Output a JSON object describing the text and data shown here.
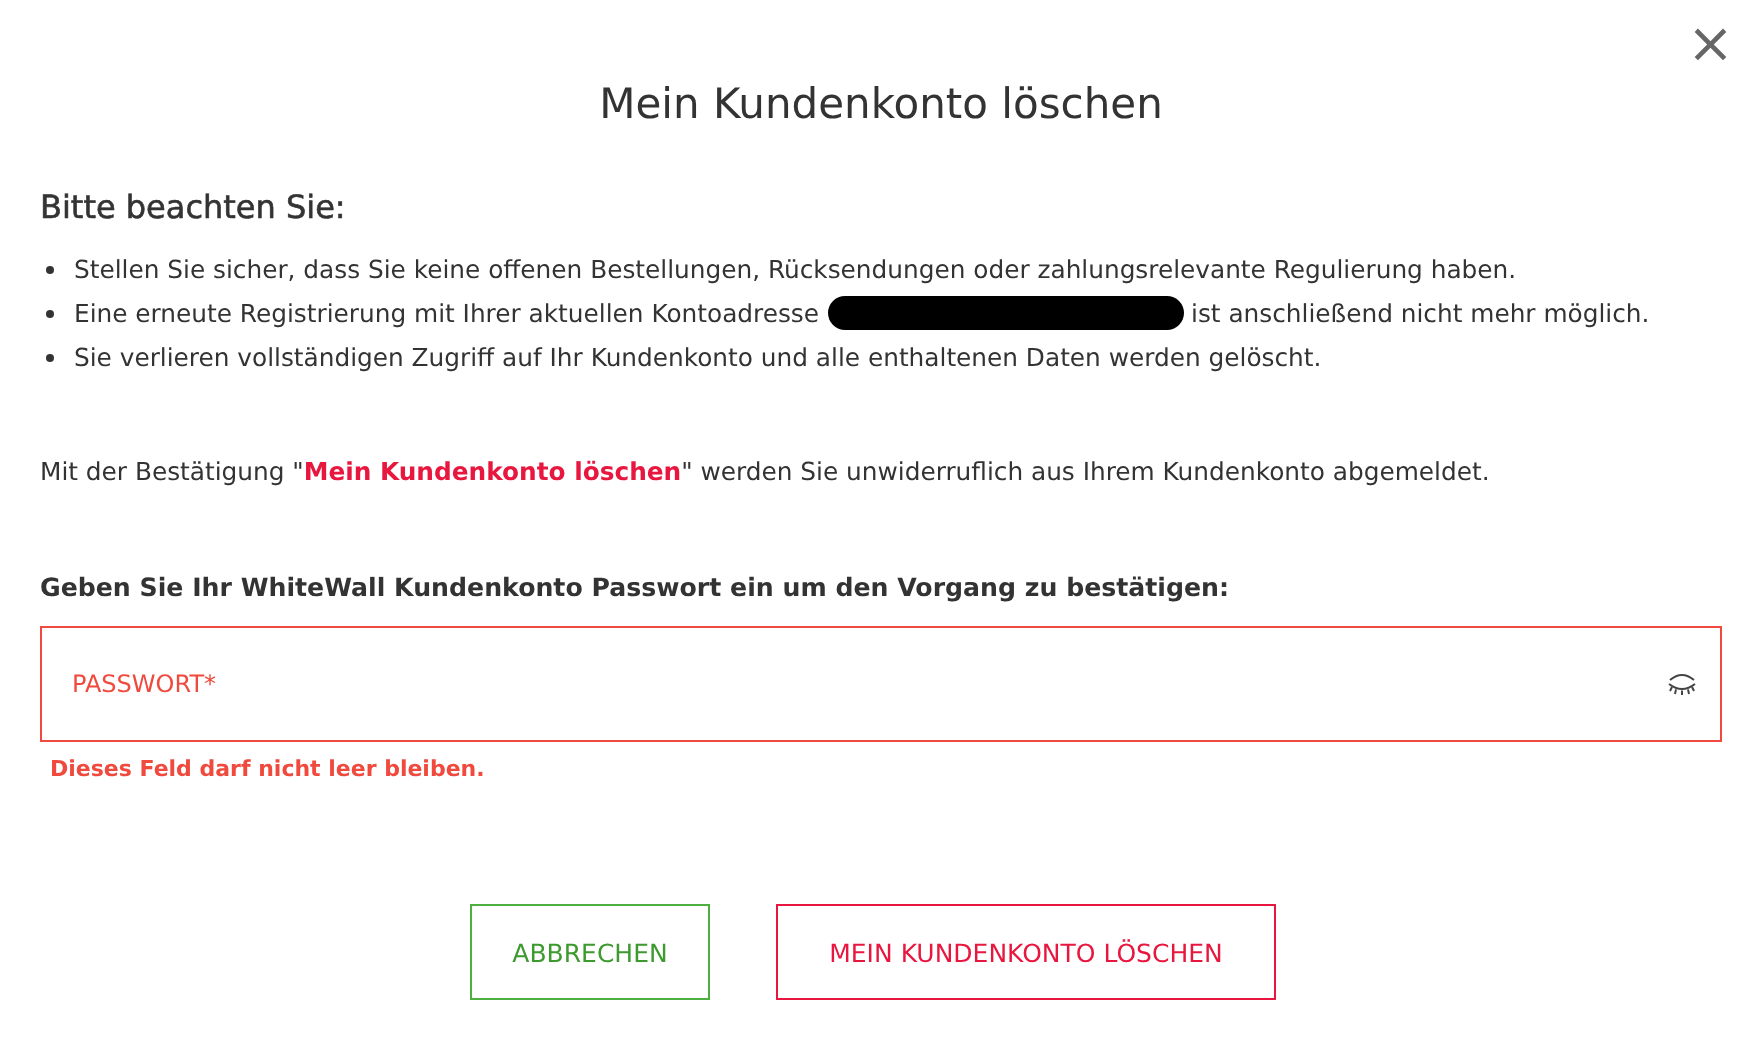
{
  "dialog": {
    "title": "Mein Kundenkonto löschen",
    "close": "×"
  },
  "notice": {
    "heading": "Bitte beachten Sie:",
    "bullets": [
      {
        "segments": [
          {
            "kind": "text",
            "text": "Stellen Sie sicher, dass Sie keine offenen Bestellungen, Rücksendungen oder zahlungsrelevante Regulierung haben."
          }
        ]
      },
      {
        "segments": [
          {
            "kind": "text",
            "text": "Eine erneute Registrierung mit Ihrer aktuellen Kontoadresse"
          },
          {
            "kind": "redaction"
          },
          {
            "kind": "text",
            "text": "ist anschließend nicht mehr möglich."
          }
        ]
      },
      {
        "segments": [
          {
            "kind": "text",
            "text": "Sie verlieren vollständigen Zugriff auf Ihr Kundenkonto und alle enthaltenen Daten werden gelöscht."
          }
        ]
      }
    ]
  },
  "confirmation": "Mit der Bestätigung \"**Mein Kundenkonto löschen**\" werden Sie unwiderruflich aus Ihrem Kundenkonto abgemeldet.",
  "password": {
    "label": "Geben Sie Ihr WhiteWall Kundenkonto Passwort ein um den Vorgang zu bestätigen:",
    "placeholder": "PASSWORT*",
    "invalid": true,
    "error": "Dieses Feld darf nicht leer bleiben."
  },
  "buttons": [
    {
      "label": "ABBRECHEN",
      "kind": "cancel"
    },
    {
      "label": "MEIN KUNDENKONTO LÖSCHEN",
      "kind": "danger"
    }
  ]
}
